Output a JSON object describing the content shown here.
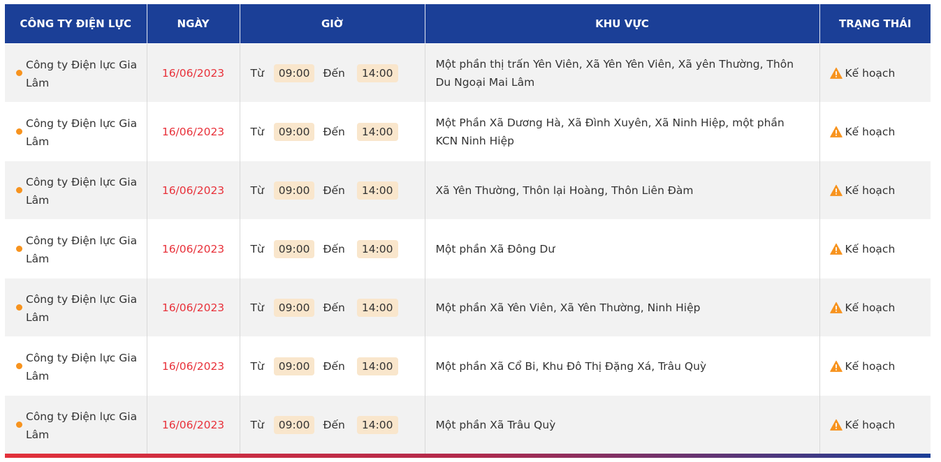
{
  "headers": [
    "CÔNG TY ĐIỆN LỰC",
    "NGÀY",
    "GIỜ",
    "KHU VỰC",
    "TRẠNG THÁI"
  ],
  "labels": {
    "from": "Từ",
    "to": "Đến"
  },
  "colors": {
    "header_bg": "#1b3f97",
    "date": "#e8313a",
    "dot": "#f7931e",
    "time_chip": "#f9e6cc",
    "warning": "#f7931e"
  },
  "rows": [
    {
      "company": "Công ty Điện lực Gia Lâm",
      "date": "16/06/2023",
      "start": "09:00",
      "end": "14:00",
      "area": "Một phần thị trấn Yên Viên, Xã Yên Yên Viên, Xã yên Thường, Thôn Du Ngoại Mai Lâm",
      "status": "Kế hoạch",
      "status_icon": "warning-icon"
    },
    {
      "company": "Công ty Điện lực Gia Lâm",
      "date": "16/06/2023",
      "start": "09:00",
      "end": "14:00",
      "area": "Một Phần Xã Dương Hà, Xã Đình Xuyên, Xã Ninh Hiệp, một phần KCN Ninh Hiệp",
      "status": "Kế hoạch",
      "status_icon": "warning-icon"
    },
    {
      "company": "Công ty Điện lực Gia Lâm",
      "date": "16/06/2023",
      "start": "09:00",
      "end": "14:00",
      "area": "Xã Yên Thường, Thôn lại Hoàng, Thôn Liên Đàm",
      "status": "Kế hoạch",
      "status_icon": "warning-icon"
    },
    {
      "company": "Công ty Điện lực Gia Lâm",
      "date": "16/06/2023",
      "start": "09:00",
      "end": "14:00",
      "area": "Một phần Xã Đông Dư",
      "status": "Kế hoạch",
      "status_icon": "warning-icon"
    },
    {
      "company": "Công ty Điện lực Gia Lâm",
      "date": "16/06/2023",
      "start": "09:00",
      "end": "14:00",
      "area": "Một phần Xã Yên Viên, Xã Yên Thường, Ninh Hiệp",
      "status": "Kế hoạch",
      "status_icon": "warning-icon"
    },
    {
      "company": "Công ty Điện lực Gia Lâm",
      "date": "16/06/2023",
      "start": "09:00",
      "end": "14:00",
      "area": "Một phần Xã Cổ Bi, Khu Đô Thị Đặng Xá, Trâu Quỳ",
      "status": "Kế hoạch",
      "status_icon": "warning-icon"
    },
    {
      "company": "Công ty Điện lực Gia Lâm",
      "date": "16/06/2023",
      "start": "09:00",
      "end": "14:00",
      "area": "Một phần Xã Trâu Quỳ",
      "status": "Kế hoạch",
      "status_icon": "warning-icon"
    }
  ]
}
